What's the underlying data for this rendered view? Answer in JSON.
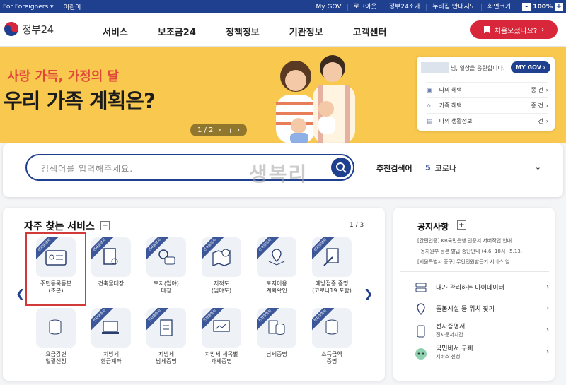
{
  "util": {
    "foreigners": "For Foreigners",
    "kids": "어린이",
    "links": [
      "My GOV",
      "로그아웃",
      "정부24소개",
      "누리집 안내지도",
      "화면크기"
    ],
    "zoom_minus": "-",
    "zoom": "100%",
    "zoom_plus": "+"
  },
  "header": {
    "logo": "정부24",
    "nav": [
      "서비스",
      "보조금24",
      "정책정보",
      "기관정보",
      "고객센터"
    ],
    "first_visit": "처음오셨나요?"
  },
  "banner": {
    "subtitle": "사랑 가득, 가정의 달",
    "title": "우리 가족 계획은?",
    "pager": "1 / 2"
  },
  "mygov": {
    "greeting": "님, 일상을 응원합니다.",
    "button": "MY GOV",
    "rows": [
      {
        "icon": "briefcase-icon",
        "label": "나의 혜택",
        "count": "종   건"
      },
      {
        "icon": "house-icon",
        "label": "가족 혜택",
        "count": "종   건"
      },
      {
        "icon": "box-icon",
        "label": "나의 생활정보",
        "count": "건"
      }
    ]
  },
  "search": {
    "placeholder": "검색어를 입력해주세요.",
    "watermark": "생복리",
    "rec_label": "추천검색어",
    "rec_num": "5",
    "rec_text": "코로나"
  },
  "services": {
    "title": "자주 찾는 서비스",
    "page": "1 / 3",
    "badge": "전자증명서",
    "row1": [
      "주민등록등본\n(초본)",
      "건축물대장",
      "토지(임야)\n대장",
      "지적도\n(임야도)",
      "토지이용\n계획확인",
      "예방접종 증명\n(코로나19 포함)"
    ],
    "row2": [
      "요금감면\n일괄신청",
      "지방세\n환급계좌",
      "지방세\n납세증명",
      "지방세 세목별\n과세증명",
      "납세증명",
      "소득금액\n증명"
    ]
  },
  "notice": {
    "title": "공지사항",
    "items": [
      "[간편인증] KB국민은행 인증서 서버작업 안내",
      "· 농지원부 등본 발급 중단안내 (4.6. 18시~5.13.",
      "[서울특별시 중구] 무인민원발급기 서비스 일..."
    ],
    "links": [
      {
        "label": "내가 관리하는 마이데이터",
        "sub": ""
      },
      {
        "label": "돌봄시설 등 위치 찾기",
        "sub": ""
      },
      {
        "label": "전자증명서",
        "sub": "전자문서지갑"
      },
      {
        "label": "국민비서 구삐",
        "sub": "서비스 신청"
      }
    ]
  },
  "colors": {
    "primary": "#1f3f8f",
    "accent": "#d8273a",
    "banner": "#f9c94f"
  }
}
